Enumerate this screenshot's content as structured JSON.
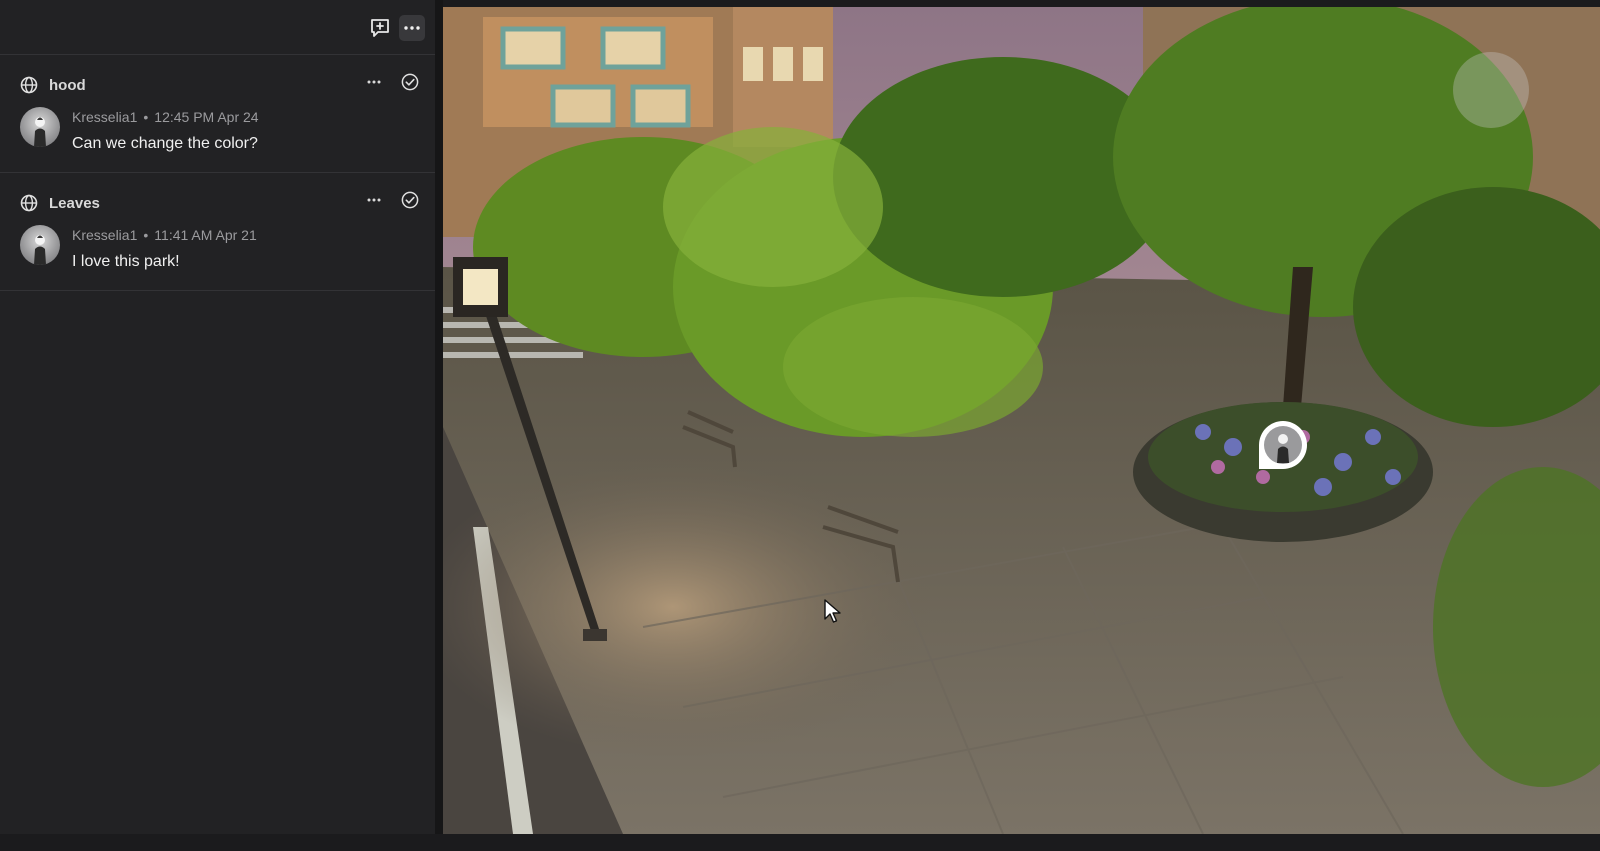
{
  "sidebar": {
    "toolbar": {
      "new_comment_icon": "comment-plus-icon",
      "more_icon": "ellipsis-icon"
    },
    "threads": [
      {
        "title": "hood",
        "scope_icon": "globe-icon",
        "author": "Kresselia1",
        "separator": "•",
        "timestamp": "12:45 PM Apr 24",
        "message": "Can we change the color?"
      },
      {
        "title": "Leaves",
        "scope_icon": "globe-icon",
        "author": "Kresselia1",
        "separator": "•",
        "timestamp": "11:41 AM Apr 21",
        "message": "I love this park!"
      }
    ]
  },
  "viewport": {
    "scene": "3d-park-scene",
    "comment_pin_icon": "comment-pin-avatar-icon",
    "cursor_icon": "mouse-pointer-icon"
  },
  "colors": {
    "panel_bg": "#222224",
    "app_bg": "#1b1b1d",
    "text_primary": "#f0f0f0",
    "text_muted": "#9b9b9e"
  }
}
